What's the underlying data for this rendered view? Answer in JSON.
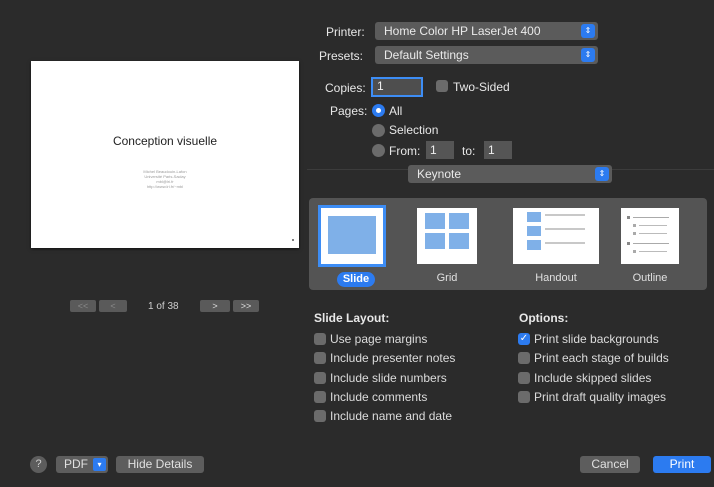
{
  "preview": {
    "title": "Conception visuelle",
    "lines": [
      "Michel Beaudouin-Lafon",
      "Université Paris-Saclay",
      "mbl@lri.fr",
      "http://www.lri.fr/~mbl"
    ],
    "page_indicator": "1 of 38",
    "first": "<<",
    "prev": "<",
    "next": ">",
    "last": ">>"
  },
  "printer": {
    "label": "Printer:",
    "value": "Home Color HP LaserJet 400"
  },
  "presets": {
    "label": "Presets:",
    "value": "Default Settings"
  },
  "copies": {
    "label": "Copies:",
    "value": "1",
    "two_sided": "Two-Sided"
  },
  "pages": {
    "label": "Pages:",
    "all": "All",
    "selection": "Selection",
    "from": "From:",
    "from_value": "1",
    "to": "to:",
    "to_value": "1"
  },
  "app_popup": {
    "value": "Keynote"
  },
  "layouts": {
    "slide": "Slide",
    "grid": "Grid",
    "handout": "Handout",
    "outline": "Outline"
  },
  "slide_layout": {
    "title": "Slide Layout:",
    "items": [
      "Use page margins",
      "Include presenter notes",
      "Include slide numbers",
      "Include comments",
      "Include name and date"
    ]
  },
  "options": {
    "title": "Options:",
    "items": [
      "Print slide backgrounds",
      "Print each stage of builds",
      "Include skipped slides",
      "Print draft quality images"
    ]
  },
  "bottom": {
    "help": "?",
    "pdf": "PDF",
    "hide_details": "Hide Details",
    "cancel": "Cancel",
    "print": "Print"
  },
  "colors": {
    "accent": "#2c7bf0",
    "background": "#2b2b2b",
    "control": "#5b5b5b"
  }
}
